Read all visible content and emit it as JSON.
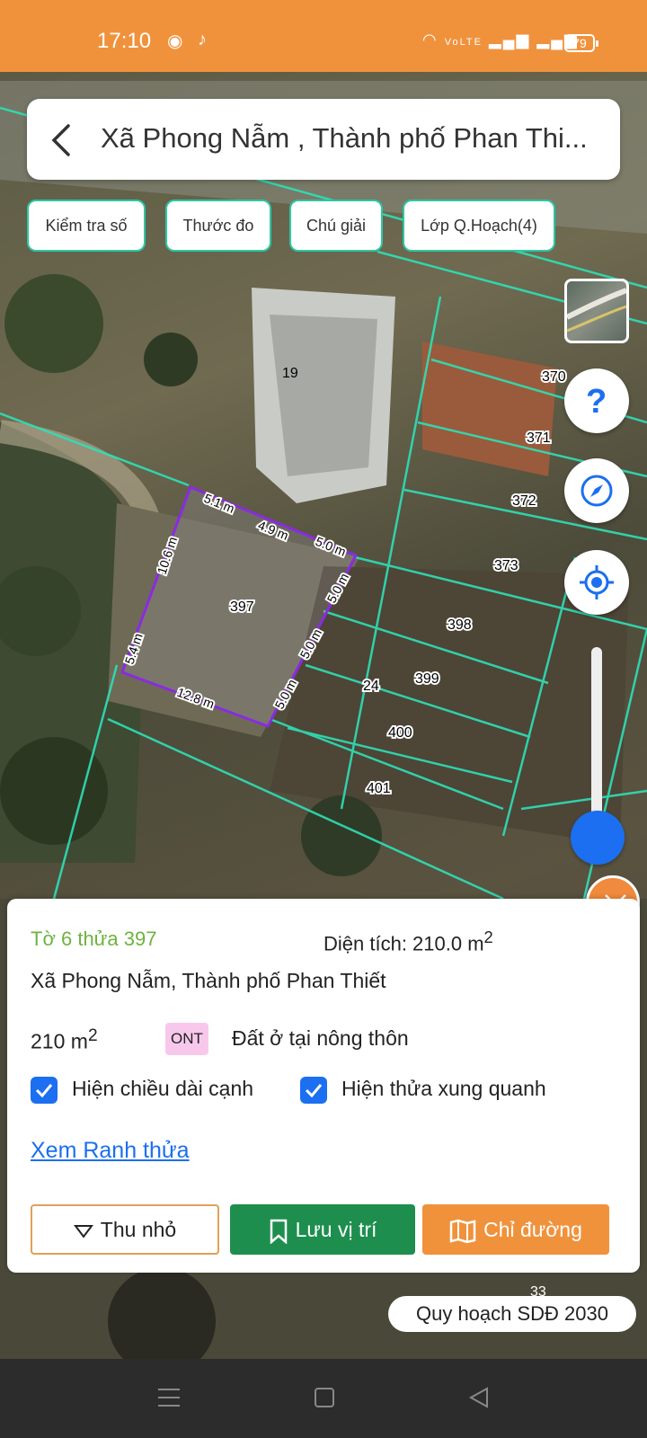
{
  "status_bar": {
    "time": "17:10",
    "battery": "79",
    "network": "VoLTE"
  },
  "header": {
    "title": "Xã Phong Nẫm , Thành phố Phan Thi..."
  },
  "chips": [
    "Kiểm tra số",
    "Thước đo",
    "Chú giải",
    "Lớp Q.Hoạch(4)"
  ],
  "map": {
    "parcel_labels": [
      "19",
      "370",
      "371",
      "372",
      "373",
      "397",
      "398",
      "399",
      "24",
      "400",
      "401",
      "33"
    ],
    "edge_labels": [
      "5.1 m",
      "4.9 m",
      "5.0 m",
      "5.0 m",
      "5.0 m",
      "5.0 m",
      "12.8 m",
      "5.4 m",
      "10.6 m"
    ],
    "plan_layer": "Quy hoạch SDĐ 2030"
  },
  "panel": {
    "parcel": "Tờ 6 thửa 397",
    "area_label": "Diện tích: 210.0 m",
    "area_sup": "2",
    "address": "Xã Phong Nẫm, Thành phố Phan Thiết",
    "size": "210 m",
    "size_sup": "2",
    "land_code": "ONT",
    "land_type": "Đất ở tại nông thôn",
    "checkbox_edges": "Hiện chiều dài cạnh",
    "checkbox_neighbors": "Hiện thửa xung quanh",
    "link": "Xem Ranh thửa",
    "btn_shrink": "Thu nhỏ",
    "btn_save": "Lưu vị trí",
    "btn_route": "Chỉ đường"
  },
  "colors": {
    "accent_orange": "#f0923c",
    "green": "#1e8e4e",
    "blue": "#1b6ff0",
    "parcel_outline": "#8a2be2",
    "boundary": "#2ee0b8"
  },
  "icons": [
    "back-icon",
    "help-icon",
    "compass-icon",
    "locate-icon",
    "close-icon",
    "chevron-down-icon",
    "bookmark-icon",
    "map-icon"
  ]
}
